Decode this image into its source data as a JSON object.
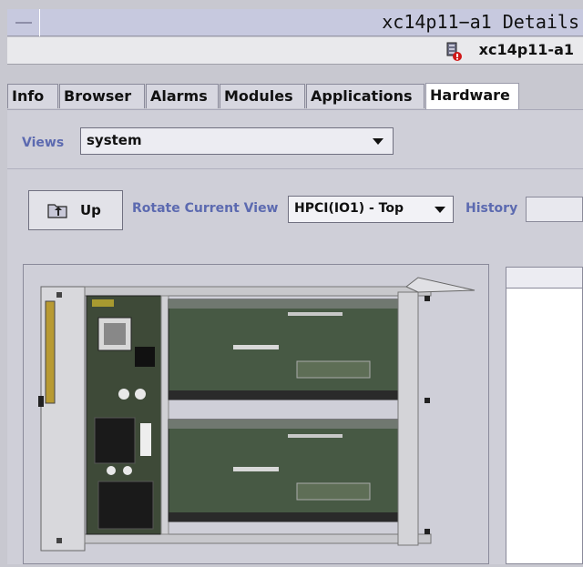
{
  "window": {
    "title": "xc14p11−a1 Details",
    "host_name": "xc14p11-a1"
  },
  "tabs": [
    {
      "label": "Info",
      "active": false
    },
    {
      "label": "Browser",
      "active": false
    },
    {
      "label": "Alarms",
      "active": false
    },
    {
      "label": "Modules",
      "active": false
    },
    {
      "label": "Applications",
      "active": false
    },
    {
      "label": "Hardware",
      "active": true
    }
  ],
  "views": {
    "label": "Views",
    "selected": "system"
  },
  "toolbar": {
    "up_label": "Up",
    "rotate_label": "Rotate Current View",
    "rotate_selected": "HPCI(IO1) - Top",
    "history_label": "History"
  },
  "colors": {
    "label_blue": "#5c6ab0",
    "title_bg": "#c7c9df"
  },
  "icons": {
    "host": "server-alarm-icon",
    "up": "folder-up-icon"
  }
}
